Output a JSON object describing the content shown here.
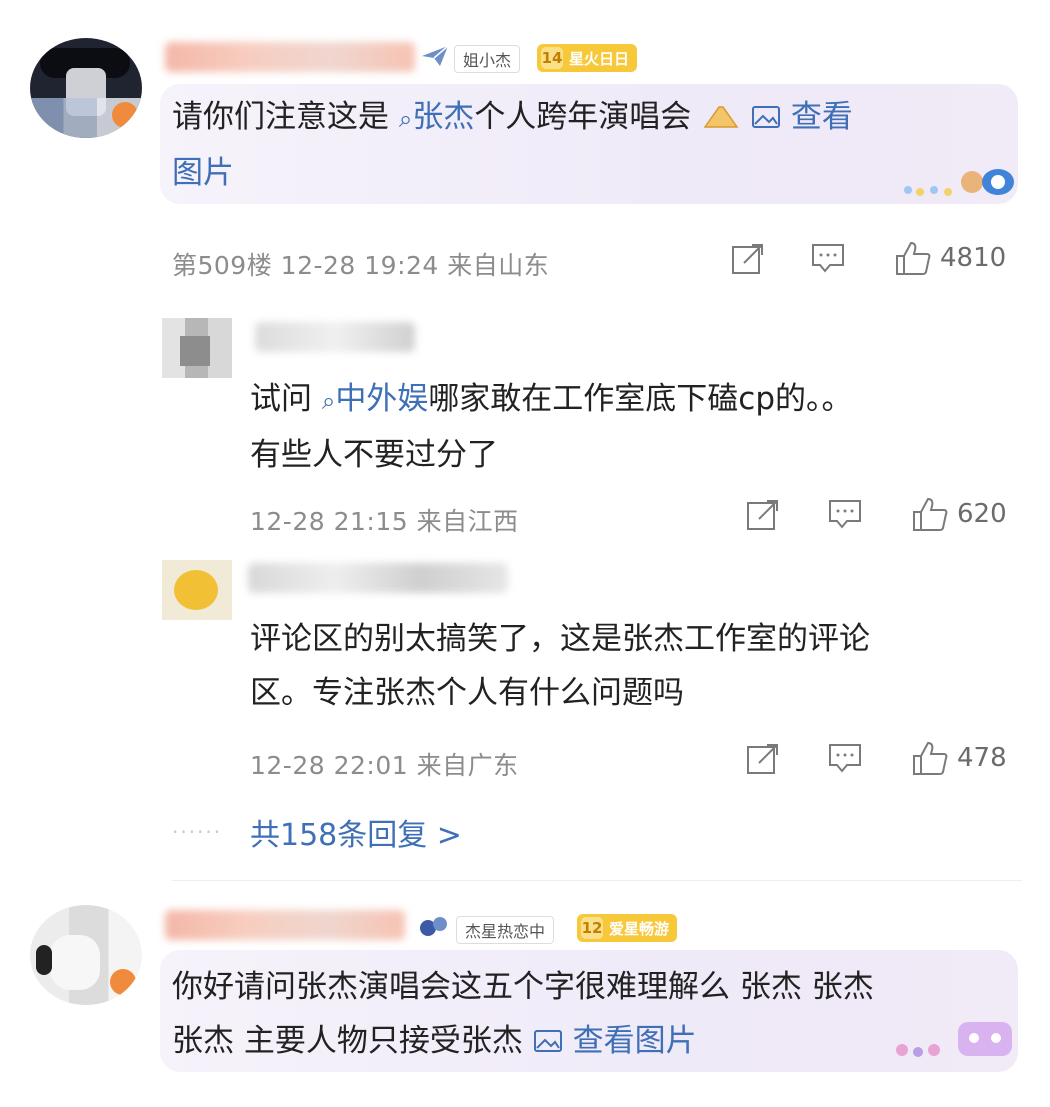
{
  "comments": [
    {
      "tag_text": "姐小杰",
      "level": "14",
      "level_text": "星火日日",
      "content_prefix": "请你们注意这是 ",
      "content_link": "张杰",
      "content_suffix": "个人跨年演唱会",
      "view_image_label": "查看",
      "view_image_label_2": "图片",
      "meta": "第509楼 12-28 19:24 来自山东",
      "like_count": "4810",
      "share_icon": "share-icon",
      "comment_icon": "comment-icon",
      "like_icon": "thumbs-up-icon"
    },
    {
      "content_prefix": "试问 ",
      "content_link": "中外娱",
      "content_suffix_line1": "哪家敢在工作室底下磕cp的。。",
      "content_line2": "有些人不要过分了",
      "meta": "12-28 21:15 来自江西",
      "like_count": "620"
    },
    {
      "content_line1": "评论区的别太搞笑了，这是张杰工作室的评论",
      "content_line2": "区。专注张杰个人有什么问题吗",
      "meta": "12-28 22:01 来自广东",
      "like_count": "478"
    },
    {
      "tag_text": "杰星热恋中",
      "level": "12",
      "level_text": "爱星畅游",
      "content_line1": "你好请问张杰演唱会这五个字很难理解么 张杰 张杰",
      "content_line2_prefix": "张杰 主要人物只接受张杰 ",
      "view_image_label": "查看图片"
    }
  ],
  "more_replies": "共158条回复 >",
  "dots": "······",
  "colors": {
    "link": "#3f6fb6",
    "meta": "#8c8c8c",
    "level_badge": "#f7c83a",
    "bubble": "#f1ecf8"
  }
}
